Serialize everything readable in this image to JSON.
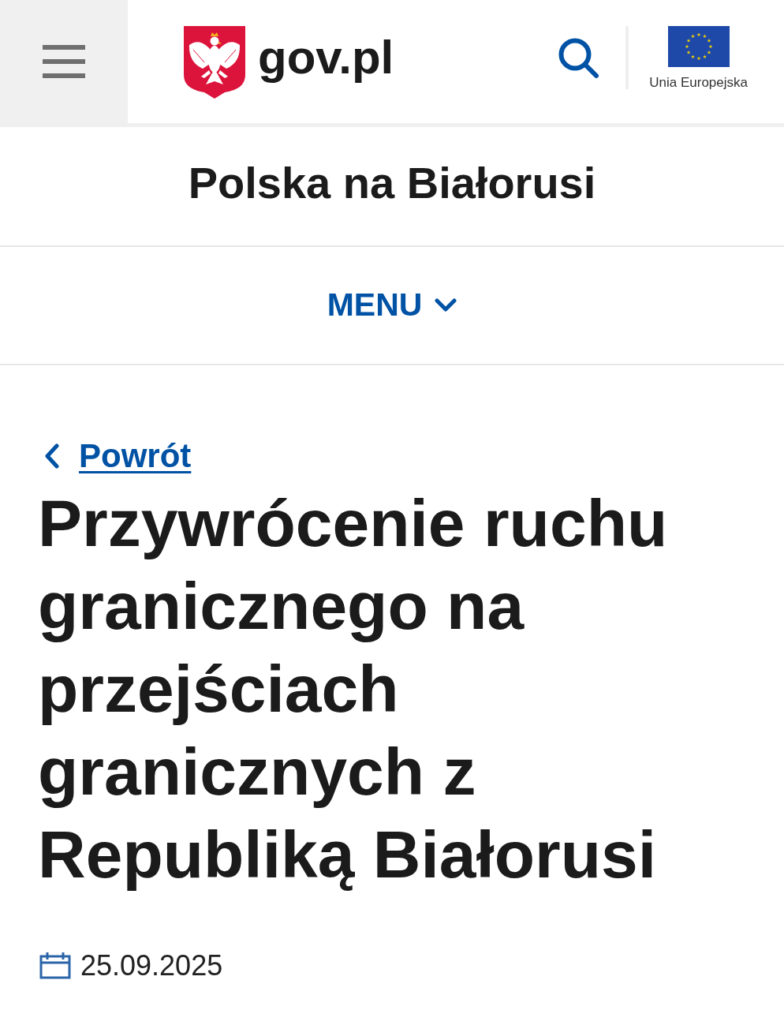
{
  "header": {
    "logo": {
      "text": "gov.pl"
    },
    "eu_logo": {
      "caption": "Unia Europejska"
    }
  },
  "site_title": "Polska na Białorusi",
  "nav": {
    "label": "MENU",
    "expanded": false
  },
  "article": {
    "back_link": "Powrót",
    "title": "Przywrócenie ruchu granicznego na przejściach granicznych z Republiką Białorusi",
    "date": "25.09.2025"
  }
}
